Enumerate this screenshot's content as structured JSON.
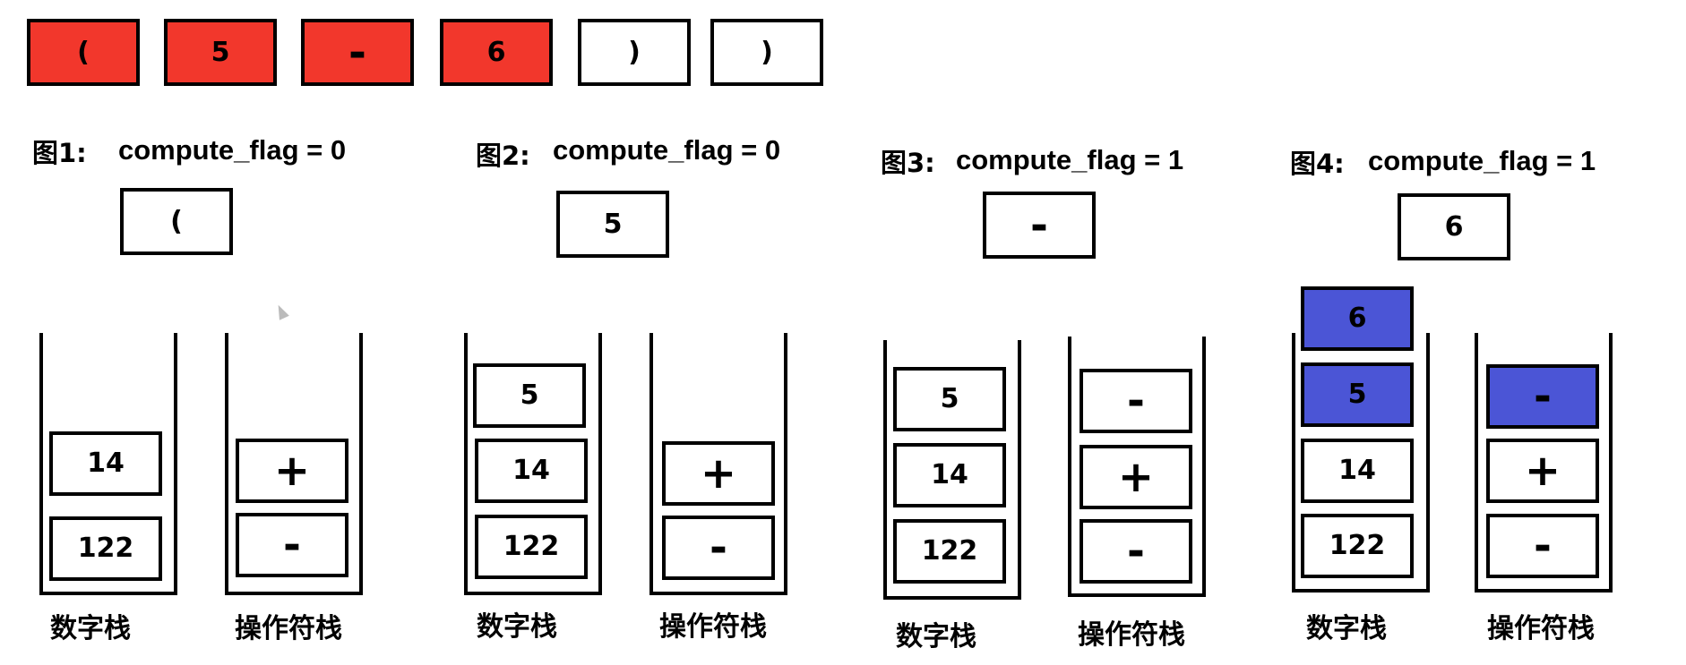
{
  "tokens": [
    "(",
    "5",
    "-",
    "6",
    ")",
    ")"
  ],
  "panels": [
    {
      "figure": "图1:",
      "flag_text": "compute_flag =  0",
      "current": "(",
      "num_stack": [
        "14",
        "122"
      ],
      "op_stack": [
        "+",
        "-"
      ],
      "num_label": "数字栈",
      "op_label": "操作符栈"
    },
    {
      "figure": "图2:",
      "flag_text": "compute_flag = 0",
      "current": "5",
      "num_stack": [
        "5",
        "14",
        "122"
      ],
      "op_stack": [
        "+",
        "-"
      ],
      "num_label": "数字栈",
      "op_label": "操作符栈"
    },
    {
      "figure": "图3:",
      "flag_text": "compute_flag =  1",
      "current": "-",
      "num_stack": [
        "5",
        "14",
        "122"
      ],
      "op_stack": [
        "-",
        "+",
        "-"
      ],
      "num_label": "数字栈",
      "op_label": "操作符栈"
    },
    {
      "figure": "图4:",
      "flag_text": "compute_flag = 1",
      "current": "6",
      "num_stack": [
        "6",
        "5",
        "14",
        "122"
      ],
      "op_stack": [
        "-",
        "+",
        "-"
      ],
      "num_label": "数字栈",
      "op_label": "操作符栈"
    }
  ],
  "colors": {
    "token_consumed": "#f2372c",
    "highlight": "#4b55d6",
    "border": "#000000",
    "background": "#ffffff"
  }
}
